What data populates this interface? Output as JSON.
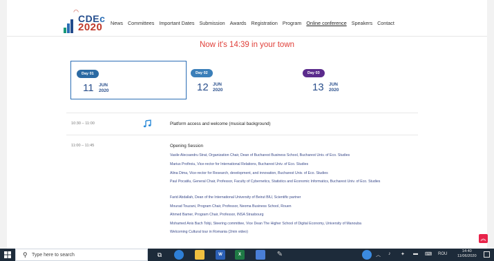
{
  "logo": {
    "name_part1": "CDE",
    "name_part2": "c",
    "year": "2020"
  },
  "nav": [
    {
      "label": "News"
    },
    {
      "label": "Committees"
    },
    {
      "label": "Important Dates"
    },
    {
      "label": "Submission"
    },
    {
      "label": "Awards"
    },
    {
      "label": "Registration"
    },
    {
      "label": "Program"
    },
    {
      "label": "Online conference",
      "active": true
    },
    {
      "label": "Speakers"
    },
    {
      "label": "Contact"
    }
  ],
  "now_text": "Now it's 14:39 in your town",
  "days": [
    {
      "label": "Day 01",
      "day": "11",
      "month": "JUN",
      "year": "2020",
      "pill_color": "#2b6aa3"
    },
    {
      "label": "Day 02",
      "day": "12",
      "month": "JUN",
      "year": "2020",
      "pill_color": "#3b7fb9"
    },
    {
      "label": "Day 03",
      "day": "13",
      "month": "JUN",
      "year": "2020",
      "pill_color": "#5b2b8c"
    }
  ],
  "program": [
    {
      "time": "10:30 – 11:00",
      "icon": "music-note-icon",
      "title": "Platform access and welcome (musical background)",
      "speakers": []
    },
    {
      "time": "11:00 – 11:45",
      "title": "Opening Session",
      "speakers": [
        "Vasile Alecsandru Strat, Organization Chair, Dean of Bucharest Business School, Bucharest Univ. of Eco. Studies",
        "Marius Profiroiu, Vice-rector for International Relations, Bucharest Univ. of Eco. Studies",
        "Alina Dima, Vice-rector for Research, development, and innovation, Bucharest Univ. of Eco. Studies",
        "Paul Pocatilu, General Chair, Professor, Faculty of Cybernetics, Statistics and Economic Informatics, Bucharest Univ. of Eco. Studies",
        "Farid Abdallah, Dean of the International University of Beirut BIU, Scientific partner",
        "Mourad Touzani, Program Chair, Professor, Neoma Business School, Rouen",
        "Ahmed Bamer, Program Chair, Professor, INSA Strasbourg",
        "Mohamed Anis Bach Tobji, Steering committee, Vice Dean The Higher School of Digital Economy, University of Manouba",
        "Welcoming Cultural tour in Romania (2min video)"
      ]
    }
  ],
  "scroll_top_icon": "chevron-up-icon",
  "taskbar": {
    "search_placeholder": "Type here to search",
    "language": "ROU",
    "time": "14:40",
    "date": "11/06/2020"
  },
  "colors": {
    "accent_red": "#e0403a",
    "navy": "#2a4f8c",
    "taskbar": "#1d2b3a"
  }
}
